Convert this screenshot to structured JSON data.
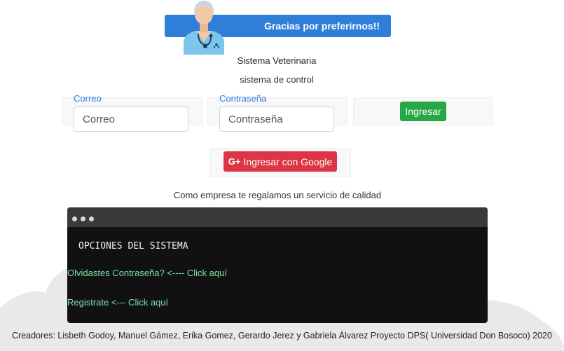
{
  "banner": {
    "text": "Gracias por preferirnos!!"
  },
  "app": {
    "title": "Sistema Veterinaria",
    "subtitle": "sistema de control"
  },
  "login": {
    "email_label": "Correo",
    "email_placeholder": "Correo",
    "password_label": "Contraseña",
    "password_placeholder": "Contraseña",
    "submit_label": "Ingresar"
  },
  "google": {
    "icon": "G+",
    "label": "Ingresar con Google"
  },
  "tagline": "Como empresa te regalamos un servicio de calidad",
  "terminal": {
    "heading": "OPCIONES DEL SISTEMA",
    "forgot_link": "Olvidastes Contraseña? <---- Click aquí",
    "register_link": "Registrate <--- Click aquí"
  },
  "footer": "Creadores: Lisbeth Godoy, Manuel Gámez, Erika Gomez, Gerardo Jerez y Gabriela Álvarez Proyecto DPS( Universidad Don Bosoco) 2020",
  "colors": {
    "primary": "#2f7fd8",
    "success": "#28a745",
    "danger": "#dc3545",
    "terminal_bg": "#111111",
    "terminal_link": "#7ee0a5"
  }
}
